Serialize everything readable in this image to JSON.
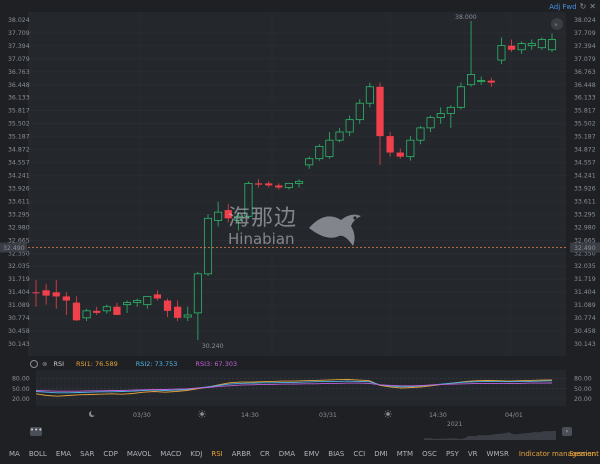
{
  "toolbar": {
    "adj_label": "Adj Fwd",
    "refresh_icon": "refresh-icon",
    "close_icon": "close-icon"
  },
  "watermark": {
    "chinese": "海那边",
    "english": "Hinabian"
  },
  "price_axis": {
    "ticks": [
      "38.024",
      "37.709",
      "37.394",
      "37.079",
      "36.763",
      "36.448",
      "36.133",
      "35.817",
      "35.502",
      "35.187",
      "34.872",
      "34.557",
      "34.241",
      "33.926",
      "33.611",
      "33.295",
      "32.980",
      "32.665",
      "32.350",
      "32.035",
      "31.719",
      "31.404",
      "31.089",
      "30.774",
      "30.458",
      "30.143"
    ],
    "current_price": "32.490",
    "high_label": "38.000",
    "low_label": "30.240"
  },
  "candles": [
    {
      "o": 31.4,
      "h": 31.7,
      "l": 31.05,
      "c": 31.38
    },
    {
      "o": 31.45,
      "h": 31.6,
      "l": 31.1,
      "c": 31.32
    },
    {
      "o": 31.4,
      "h": 31.7,
      "l": 31.0,
      "c": 31.3
    },
    {
      "o": 31.3,
      "h": 31.4,
      "l": 30.85,
      "c": 31.2
    },
    {
      "o": 31.15,
      "h": 31.3,
      "l": 30.7,
      "c": 30.72
    },
    {
      "o": 30.78,
      "h": 31.0,
      "l": 30.7,
      "c": 30.95
    },
    {
      "o": 30.95,
      "h": 31.05,
      "l": 30.85,
      "c": 30.9
    },
    {
      "o": 30.95,
      "h": 31.1,
      "l": 30.88,
      "c": 31.05
    },
    {
      "o": 31.05,
      "h": 31.15,
      "l": 30.85,
      "c": 30.85
    },
    {
      "o": 31.1,
      "h": 31.2,
      "l": 30.9,
      "c": 31.15
    },
    {
      "o": 31.15,
      "h": 31.25,
      "l": 31.05,
      "c": 31.2
    },
    {
      "o": 31.1,
      "h": 31.3,
      "l": 31.0,
      "c": 31.3
    },
    {
      "o": 31.35,
      "h": 31.45,
      "l": 31.2,
      "c": 31.25
    },
    {
      "o": 31.2,
      "h": 31.25,
      "l": 30.8,
      "c": 30.95
    },
    {
      "o": 31.05,
      "h": 31.2,
      "l": 30.7,
      "c": 30.78
    },
    {
      "o": 30.8,
      "h": 31.05,
      "l": 30.7,
      "c": 30.85
    },
    {
      "o": 30.9,
      "h": 31.9,
      "l": 30.24,
      "c": 31.85
    },
    {
      "o": 31.85,
      "h": 33.3,
      "l": 31.8,
      "c": 33.2
    },
    {
      "o": 33.15,
      "h": 33.6,
      "l": 33.0,
      "c": 33.35
    },
    {
      "o": 33.4,
      "h": 33.55,
      "l": 33.1,
      "c": 33.2
    },
    {
      "o": 33.15,
      "h": 33.35,
      "l": 32.9,
      "c": 33.25
    },
    {
      "o": 33.25,
      "h": 34.1,
      "l": 33.2,
      "c": 34.05
    },
    {
      "o": 34.05,
      "h": 34.15,
      "l": 33.95,
      "c": 34.02
    },
    {
      "o": 34.05,
      "h": 34.1,
      "l": 33.95,
      "c": 34.0
    },
    {
      "o": 34.0,
      "h": 34.05,
      "l": 33.9,
      "c": 33.95
    },
    {
      "o": 33.95,
      "h": 34.05,
      "l": 33.9,
      "c": 34.05
    },
    {
      "o": 34.05,
      "h": 34.15,
      "l": 33.95,
      "c": 34.1
    },
    {
      "o": 34.5,
      "h": 34.7,
      "l": 34.4,
      "c": 34.65
    },
    {
      "o": 34.65,
      "h": 35.0,
      "l": 34.6,
      "c": 34.95
    },
    {
      "o": 34.7,
      "h": 35.3,
      "l": 34.65,
      "c": 35.1
    },
    {
      "o": 35.1,
      "h": 35.4,
      "l": 35.05,
      "c": 35.3
    },
    {
      "o": 35.3,
      "h": 35.7,
      "l": 35.2,
      "c": 35.6
    },
    {
      "o": 35.6,
      "h": 36.1,
      "l": 35.5,
      "c": 36.0
    },
    {
      "o": 36.0,
      "h": 36.5,
      "l": 35.9,
      "c": 36.4
    },
    {
      "o": 36.4,
      "h": 36.5,
      "l": 34.5,
      "c": 35.2
    },
    {
      "o": 35.2,
      "h": 35.3,
      "l": 34.7,
      "c": 34.8
    },
    {
      "o": 34.8,
      "h": 34.9,
      "l": 34.65,
      "c": 34.7
    },
    {
      "o": 34.7,
      "h": 35.2,
      "l": 34.6,
      "c": 35.1
    },
    {
      "o": 35.1,
      "h": 35.45,
      "l": 35.0,
      "c": 35.4
    },
    {
      "o": 35.4,
      "h": 35.7,
      "l": 35.3,
      "c": 35.65
    },
    {
      "o": 35.65,
      "h": 35.9,
      "l": 35.5,
      "c": 35.75
    },
    {
      "o": 35.75,
      "h": 35.95,
      "l": 35.4,
      "c": 35.9
    },
    {
      "o": 35.9,
      "h": 36.5,
      "l": 35.85,
      "c": 36.4
    },
    {
      "o": 36.45,
      "h": 38.0,
      "l": 36.4,
      "c": 36.7
    },
    {
      "o": 36.55,
      "h": 36.65,
      "l": 36.45,
      "c": 36.55
    },
    {
      "o": 36.55,
      "h": 36.62,
      "l": 36.4,
      "c": 36.5
    },
    {
      "o": 37.05,
      "h": 37.6,
      "l": 36.95,
      "c": 37.4
    },
    {
      "o": 37.4,
      "h": 37.55,
      "l": 37.25,
      "c": 37.3
    },
    {
      "o": 37.3,
      "h": 37.5,
      "l": 37.2,
      "c": 37.45
    },
    {
      "o": 37.4,
      "h": 37.55,
      "l": 37.3,
      "c": 37.45
    },
    {
      "o": 37.35,
      "h": 37.6,
      "l": 37.3,
      "c": 37.55
    },
    {
      "o": 37.3,
      "h": 37.7,
      "l": 37.25,
      "c": 37.55
    }
  ],
  "rsi_panel": {
    "name": "RSI",
    "rsi1": "RSI1: 76.589",
    "rsi2": "RSI2: 73.753",
    "rsi3": "RSI3: 67.303",
    "levels": [
      "80.00",
      "50.00",
      "20.00"
    ],
    "rsi1_values": [
      35,
      30,
      28,
      30,
      32,
      33,
      34,
      35,
      34,
      36,
      40,
      42,
      40,
      42,
      45,
      50,
      55,
      62,
      68,
      70,
      70,
      71,
      72,
      73,
      73,
      74,
      75,
      76,
      77,
      78,
      76,
      74,
      60,
      55,
      52,
      54,
      56,
      60,
      64,
      68,
      72,
      74,
      75,
      74,
      73,
      74,
      75,
      76,
      76.589
    ],
    "rsi2_values": [
      42,
      40,
      38,
      38,
      39,
      40,
      41,
      41,
      42,
      43,
      45,
      46,
      45,
      46,
      48,
      52,
      56,
      60,
      64,
      66,
      67,
      68,
      68,
      69,
      69,
      70,
      71,
      72,
      72,
      73,
      72,
      71,
      62,
      58,
      56,
      57,
      59,
      62,
      65,
      68,
      70,
      71,
      72,
      72,
      71,
      72,
      72,
      73,
      73.753
    ],
    "rsi3_values": [
      45,
      44,
      43,
      43,
      43,
      44,
      44,
      45,
      45,
      46,
      47,
      48,
      48,
      49,
      50,
      52,
      54,
      57,
      59,
      61,
      62,
      63,
      63,
      64,
      64,
      65,
      65,
      66,
      66,
      67,
      67,
      66,
      62,
      60,
      59,
      59,
      60,
      62,
      63,
      64,
      65,
      66,
      66,
      66,
      66,
      66,
      67,
      67,
      67.303
    ],
    "color1": "#e8a33c",
    "color2": "#4db6e8",
    "color3": "#c060d8"
  },
  "time_axis": {
    "labels": [
      {
        "text": "03/30",
        "icon": "moon-icon"
      },
      {
        "text": "14:30",
        "icon": "sun-icon"
      },
      {
        "text": "03/31",
        "icon": "sun-icon"
      },
      {
        "text": "14:30",
        "icon": ""
      },
      {
        "text": "04/01",
        "icon": "sun-icon"
      }
    ]
  },
  "scrollbar": {
    "year": "2021",
    "handle": "•••",
    "arrow": "›"
  },
  "tabs": [
    "MA",
    "BOLL",
    "EMA",
    "SAR",
    "CDP",
    "MAVOL",
    "MACD",
    "KDJ",
    "RSI",
    "ARBR",
    "CR",
    "DMA",
    "EMV",
    "BIAS",
    "CCI",
    "DMI",
    "MTM",
    "OSC",
    "PSY",
    "VR",
    "WMSR"
  ],
  "active_tab": "RSI",
  "indicator_management": "Indicator management",
  "session": "Session",
  "colors": {
    "up": "#2fb86a",
    "down": "#f0404c",
    "price_line": "#e8834a",
    "accent": "#e8a33c",
    "link": "#4a8fe0"
  }
}
